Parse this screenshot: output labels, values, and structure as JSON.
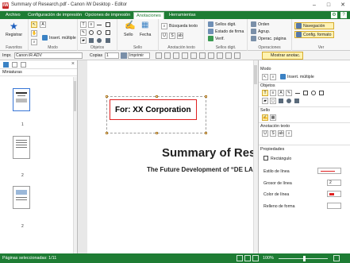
{
  "window": {
    "title": "Summary of Research.pdf - Canon iW Desktop - Editor",
    "controls": [
      "–",
      "□",
      "✕"
    ]
  },
  "tabs": [
    {
      "label": "Archivo"
    },
    {
      "label": "Configuración de impresión"
    },
    {
      "label": "Opciones de impresión"
    },
    {
      "label": "Anotaciones"
    },
    {
      "label": "Herramientas"
    }
  ],
  "ribbon": {
    "groups": {
      "favoritos": "Favoritos",
      "modo": "Modo",
      "objetos": "Objetos",
      "sello": "Sello",
      "anotacion_texto": "Anotación texto",
      "sellos_digit": "Sellos digit.",
      "operaciones": "Operaciones",
      "ver": "Ver"
    },
    "registrar": "Registrar",
    "insert_multiple": "Insert. múltiple",
    "sello": "Sello",
    "fecha": "Fecha",
    "busqueda_texto": "Búsqueda texto",
    "sellos_digit": "Sellos digit.",
    "estado_firma": "Estado de firma",
    "verif": "Verif.",
    "orden": "Orden",
    "agrup": "Agrup.",
    "operac_pagina": "Operac. página",
    "navegacion": "Navegación",
    "config_formato": "Config. formato"
  },
  "toolbar": {
    "printer_label": "Impr.",
    "printer_value": "Canon iR-ADV",
    "copies_label": "Copias",
    "copies_value": "1",
    "print_button": "Imprimir",
    "show_annotations": "Mostrar anotac."
  },
  "left_pane": {
    "title": "Miniaturas",
    "pages": [
      "1",
      "2",
      "2"
    ]
  },
  "document": {
    "annotation_text": "For: XX Corporation",
    "heading": "Summary of Res",
    "subheading": "The Future Development of “DE LA"
  },
  "right_pane": {
    "mode_title": "Modo",
    "objects_title": "Objetos",
    "insert_multiple": "Insert. múltiple",
    "stamp_title": "Sello",
    "text_anno_title": "Anotación texto",
    "properties_title": "Propiedades",
    "rectangle_label": "Rectángulo",
    "line_style_label": "Estilo de línea",
    "line_width_label": "Grosor de línea",
    "line_width_value": "2",
    "line_color_label": "Color de línea",
    "fill_label": "Relleno de forma"
  },
  "status": {
    "selected_pages": "Páginas seleccionadas: 1/11",
    "zoom": "100%"
  },
  "colors": {
    "accent": "#1e7c34",
    "annotation": "#e02020"
  }
}
